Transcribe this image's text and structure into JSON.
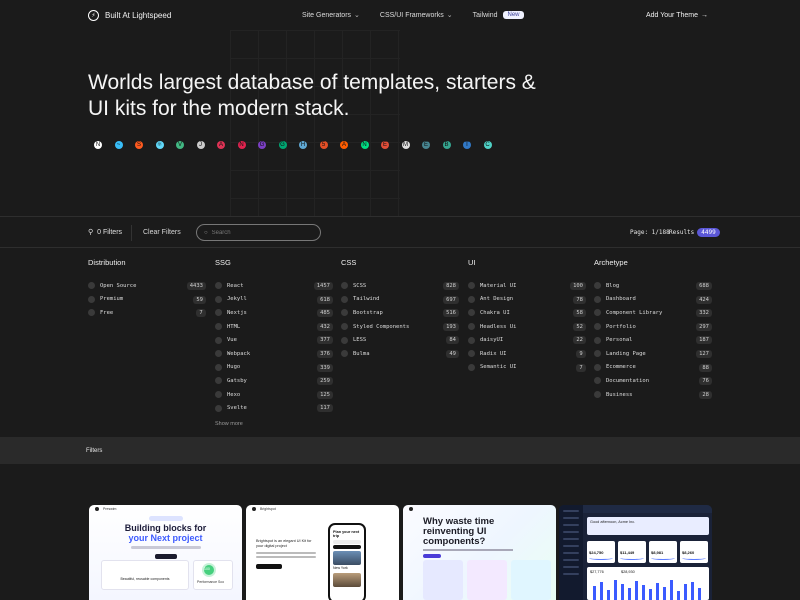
{
  "nav": {
    "brand": "Built At Lightspeed",
    "menu": [
      {
        "label": "Site Generators",
        "has_dropdown": true
      },
      {
        "label": "CSS/UI Frameworks",
        "has_dropdown": true
      },
      {
        "label": "Tailwind",
        "badge": "New"
      }
    ],
    "cta": "Add Your Theme",
    "cta_arrow": "→"
  },
  "hero": {
    "title": "Worlds largest database of templates, starters & UI kits for the modern stack.",
    "tech_icons": [
      {
        "icon": "nextjs-icon",
        "color": "#ffffff",
        "glyph": "N"
      },
      {
        "icon": "tailwind-icon",
        "color": "#38bdf8",
        "glyph": "~"
      },
      {
        "icon": "svelte-icon",
        "color": "#ff5a1f",
        "glyph": "S"
      },
      {
        "icon": "react-icon",
        "color": "#61dafb",
        "glyph": "⚛"
      },
      {
        "icon": "vue-icon",
        "color": "#42b883",
        "glyph": "V"
      },
      {
        "icon": "jekyll-icon",
        "color": "#cccccc",
        "glyph": "J"
      },
      {
        "icon": "angular-icon",
        "color": "#dd3355",
        "glyph": "A"
      },
      {
        "icon": "nest-icon",
        "color": "#e0234e",
        "glyph": "N"
      },
      {
        "icon": "gatsby-icon",
        "color": "#7b3fc4",
        "glyph": "G"
      },
      {
        "icon": "gridsome-icon",
        "color": "#00a672",
        "glyph": "G"
      },
      {
        "icon": "hugo-icon",
        "color": "#5fa8d3",
        "glyph": "H"
      },
      {
        "icon": "html5-icon",
        "color": "#e34f26",
        "glyph": "5"
      },
      {
        "icon": "astro-icon",
        "color": "#ff5d01",
        "glyph": "A"
      },
      {
        "icon": "nuxt-icon",
        "color": "#00dc82",
        "glyph": "N"
      },
      {
        "icon": "ember-icon",
        "color": "#e04e39",
        "glyph": "E"
      },
      {
        "icon": "markdown-icon",
        "color": "#dddddd",
        "glyph": "M"
      },
      {
        "icon": "electron-icon",
        "color": "#47848f",
        "glyph": "E"
      },
      {
        "icon": "bootstrap-icon",
        "color": "#35a58f",
        "glyph": "B"
      },
      {
        "icon": "typescript-icon",
        "color": "#3178c6",
        "glyph": "T"
      },
      {
        "icon": "chakra-icon",
        "color": "#4fd1c5",
        "glyph": "C"
      }
    ]
  },
  "filter_bar": {
    "filters_label": "0 Filters",
    "clear_label": "Clear Filters",
    "search_placeholder": "Search",
    "page_label": "Page: 1/188",
    "results_label": "Results",
    "results_count": "4499"
  },
  "facets": [
    {
      "title": "Distribution",
      "items": [
        {
          "label": "Open Source",
          "count": "4433"
        },
        {
          "label": "Premium",
          "count": "59"
        },
        {
          "label": "Free",
          "count": "7"
        }
      ]
    },
    {
      "title": "SSG",
      "items": [
        {
          "label": "React",
          "count": "1457"
        },
        {
          "label": "Jekyll",
          "count": "618"
        },
        {
          "label": "Nextjs",
          "count": "485"
        },
        {
          "label": "HTML",
          "count": "432"
        },
        {
          "label": "Vue",
          "count": "377"
        },
        {
          "label": "Webpack",
          "count": "376"
        },
        {
          "label": "Hugo",
          "count": "339"
        },
        {
          "label": "Gatsby",
          "count": "259"
        },
        {
          "label": "Hexo",
          "count": "125"
        },
        {
          "label": "Svelte",
          "count": "117"
        }
      ],
      "show_more": "Show more"
    },
    {
      "title": "CSS",
      "items": [
        {
          "label": "SCSS",
          "count": "828"
        },
        {
          "label": "Tailwind",
          "count": "697"
        },
        {
          "label": "Bootstrap",
          "count": "516"
        },
        {
          "label": "Styled Components",
          "count": "193"
        },
        {
          "label": "LESS",
          "count": "84"
        },
        {
          "label": "Bulma",
          "count": "49"
        }
      ]
    },
    {
      "title": "UI",
      "items": [
        {
          "label": "Material UI",
          "count": "100"
        },
        {
          "label": "Ant Design",
          "count": "78"
        },
        {
          "label": "Chakra UI",
          "count": "58"
        },
        {
          "label": "Headless Ui",
          "count": "52"
        },
        {
          "label": "daisyUI",
          "count": "22"
        },
        {
          "label": "Radix UI",
          "count": "9"
        },
        {
          "label": "Semantic UI",
          "count": "7"
        }
      ]
    },
    {
      "title": "Archetype",
      "items": [
        {
          "label": "Blog",
          "count": "688"
        },
        {
          "label": "Dashboard",
          "count": "424"
        },
        {
          "label": "Component Library",
          "count": "332"
        },
        {
          "label": "Portfolio",
          "count": "297"
        },
        {
          "label": "Personal",
          "count": "187"
        },
        {
          "label": "Landing Page",
          "count": "127"
        },
        {
          "label": "Ecommerce",
          "count": "88"
        },
        {
          "label": "Documentation",
          "count": "76"
        },
        {
          "label": "Business",
          "count": "28"
        }
      ]
    }
  ],
  "filters_strip": {
    "label": "Filters"
  },
  "cards": {
    "card1": {
      "brand": "Preswim",
      "headline_a": "Building blocks for",
      "headline_b": "your Next project",
      "caption": "Beautiful, reusable components",
      "stat": "100",
      "stat_caption": "Performance Sco"
    },
    "card2": {
      "brand": "Brightspot",
      "intro": "Brightspot is an elegant UI Kit for your digital project",
      "phone_title": "Plan your next trip",
      "city": "New York"
    },
    "card3": {
      "headline": "Why waste time reinventing UI components?"
    },
    "card4": {
      "greeting": "Good afternoon, Acme Inc.",
      "stats": [
        "$24,750",
        "$11,449",
        "$8,981",
        "$8,260",
        "$27,776",
        "$28,930"
      ]
    }
  },
  "colors": {
    "background": "#1b1b1b",
    "accent": "#5b57d6",
    "strip": "#2a2a2a"
  }
}
